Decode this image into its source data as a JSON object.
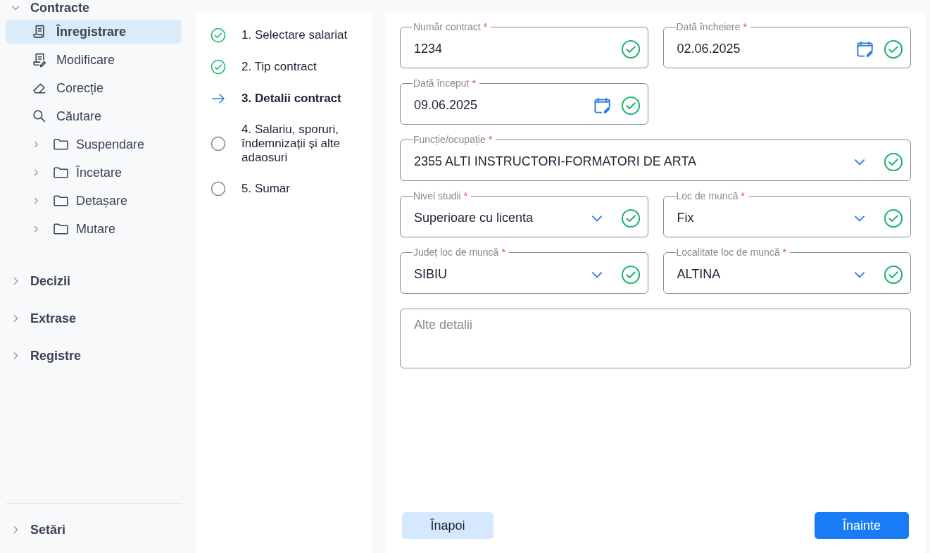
{
  "sidebar": {
    "groups": [
      {
        "label": "Contracte",
        "expanded": true,
        "items": [
          {
            "label": "Înregistrare",
            "kind": "document",
            "selected": true
          },
          {
            "label": "Modificare",
            "kind": "document-edit",
            "selected": false
          },
          {
            "label": "Corecție",
            "kind": "eraser",
            "selected": false
          },
          {
            "label": "Căutare",
            "kind": "search",
            "selected": false
          },
          {
            "label": "Suspendare",
            "kind": "folder",
            "selected": false,
            "expanded": false
          },
          {
            "label": "Încetare",
            "kind": "folder",
            "selected": false,
            "expanded": false
          },
          {
            "label": "Detașare",
            "kind": "folder",
            "selected": false,
            "expanded": false
          },
          {
            "label": "Mutare",
            "kind": "folder",
            "selected": false,
            "expanded": false
          }
        ]
      },
      {
        "label": "Decizii",
        "expanded": false
      },
      {
        "label": "Extrase",
        "expanded": false
      },
      {
        "label": "Registre",
        "expanded": false
      }
    ],
    "footer": {
      "label": "Setări",
      "expanded": false
    }
  },
  "steps": [
    {
      "label": "1. Selectare salariat",
      "completed": true,
      "selected": false
    },
    {
      "label": "2. Tip contract",
      "completed": true,
      "selected": false
    },
    {
      "label": "3. Detalii contract",
      "completed": false,
      "selected": true
    },
    {
      "label": "4. Salariu, sporuri, îndemnizații și alte adaosuri",
      "completed": false,
      "selected": false
    },
    {
      "label": "5. Sumar",
      "completed": false,
      "selected": false
    }
  ],
  "form": {
    "fields": [
      {
        "kind": "text",
        "label": "Număr contract",
        "required": "*",
        "value": "1234",
        "valid": true,
        "wide": false
      },
      {
        "kind": "date",
        "label": "Dată încheiere",
        "required": "*",
        "value": "02.06.2025",
        "valid": true,
        "wide": false
      },
      {
        "kind": "date",
        "label": "Dată început",
        "required": "*",
        "value": "09.06.2025",
        "valid": true,
        "wide": false
      },
      {
        "kind": "select",
        "label": "Funcție/ocupație",
        "required": "*",
        "value": "2355 ALTI INSTRUCTORI-FORMATORI DE ARTA",
        "valid": true,
        "wide": true
      },
      {
        "kind": "select",
        "label": "Nivel studii",
        "required": "*",
        "value": "Superioare cu licenta",
        "valid": true,
        "wide": false
      },
      {
        "kind": "select",
        "label": "Loc de muncă",
        "required": "*",
        "value": "Fix",
        "valid": true,
        "wide": false
      },
      {
        "kind": "select",
        "label": "Județ loc de muncă",
        "required": "*",
        "value": "SIBIU",
        "valid": true,
        "wide": false
      },
      {
        "kind": "select",
        "label": "Localitate loc de muncă",
        "required": "*",
        "value": "ALTINA",
        "valid": true,
        "wide": false
      },
      {
        "kind": "textarea",
        "placeholder": "Alte detalii",
        "valid": false,
        "wide": true
      }
    ],
    "buttons": [
      {
        "label": "Înapoi",
        "kind": "secondary"
      },
      {
        "label": "Înainte",
        "kind": "primary"
      }
    ]
  }
}
